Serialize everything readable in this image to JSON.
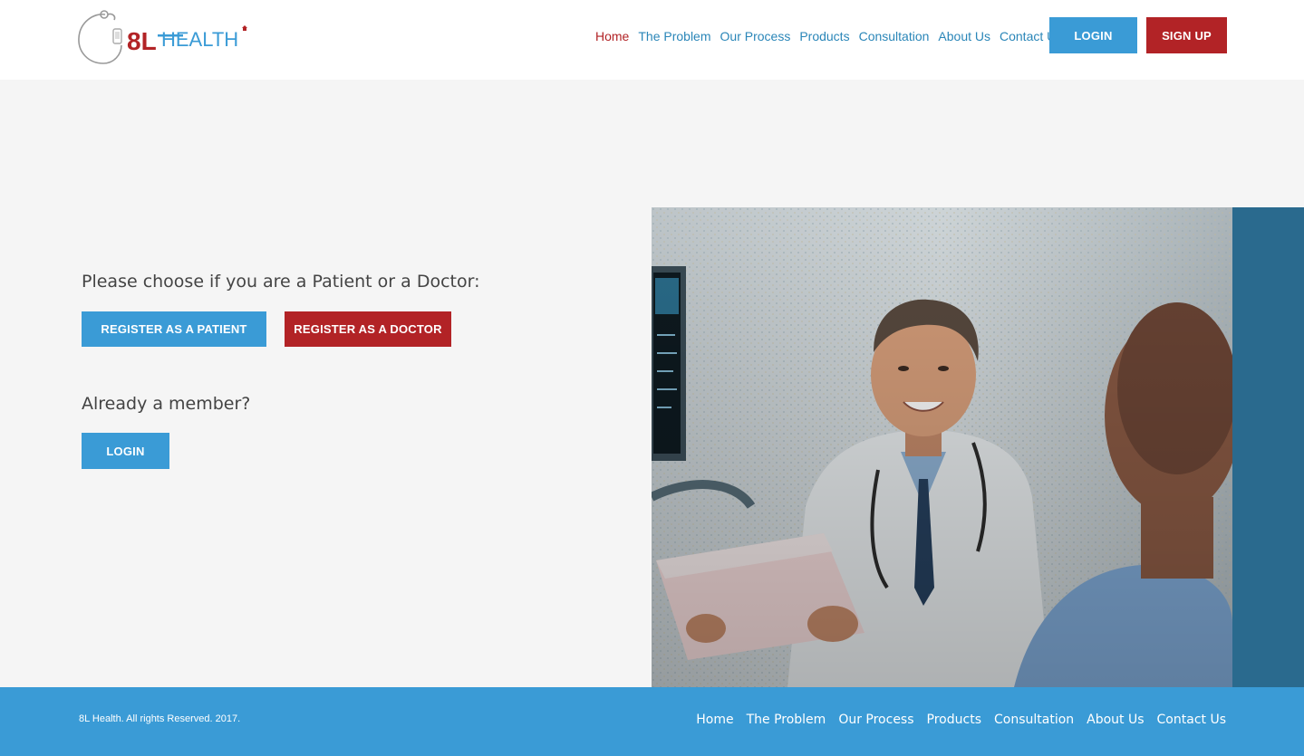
{
  "brand": {
    "logo_text_8l": "8L",
    "logo_text_health": "HEALTH",
    "color_red": "#b22326",
    "color_blue": "#3a9bd6"
  },
  "header": {
    "nav": [
      {
        "label": "Home",
        "active": true
      },
      {
        "label": "The Problem",
        "active": false
      },
      {
        "label": "Our Process",
        "active": false
      },
      {
        "label": "Products",
        "active": false
      },
      {
        "label": "Consultation",
        "active": false
      },
      {
        "label": "About Us",
        "active": false
      },
      {
        "label": "Contact Us",
        "active": false
      }
    ],
    "login_label": "LOGIN",
    "signup_label": "SIGN UP"
  },
  "main": {
    "choose_heading": "Please choose if you are a Patient or a Doctor:",
    "register_patient_label": "REGISTER AS A PATIENT",
    "register_doctor_label": "REGISTER AS A DOCTOR",
    "member_heading": "Already a member?",
    "login_label": "LOGIN"
  },
  "footer": {
    "copyright": "8L Health. All rights Reserved. 2017.",
    "nav": [
      "Home",
      "The Problem",
      "Our Process",
      "Products",
      "Consultation",
      "About Us",
      "Contact Us"
    ]
  }
}
